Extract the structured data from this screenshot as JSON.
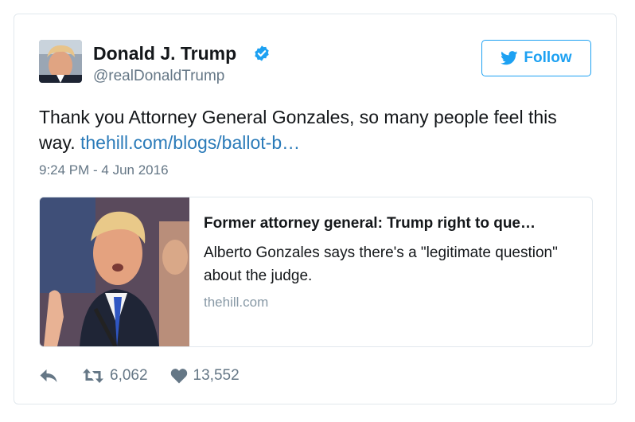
{
  "tweet": {
    "author_name": "Donald J. Trump",
    "author_handle": "@realDonaldTrump",
    "text_plain": "Thank you Attorney General Gonzales, so many people feel this way.",
    "text_link": "thehill.com/blogs/ballot-b…",
    "timestamp": "9:24 PM - 4 Jun 2016",
    "follow_label": "Follow",
    "verified": true
  },
  "link_card": {
    "title": "Former attorney general: Trump right to que…",
    "description": "Alberto Gonzales says there's a \"legitimate question\" about the judge.",
    "domain": "thehill.com"
  },
  "actions": {
    "retweets": "6,062",
    "likes": "13,552"
  },
  "colors": {
    "accent": "#1da1f2",
    "link": "#2b7bb9",
    "muted": "#657786",
    "border": "#e1e8ed"
  },
  "icons": [
    "reply-icon",
    "retweet-icon",
    "heart-icon",
    "twitter-bird-icon",
    "verified-badge-icon"
  ]
}
